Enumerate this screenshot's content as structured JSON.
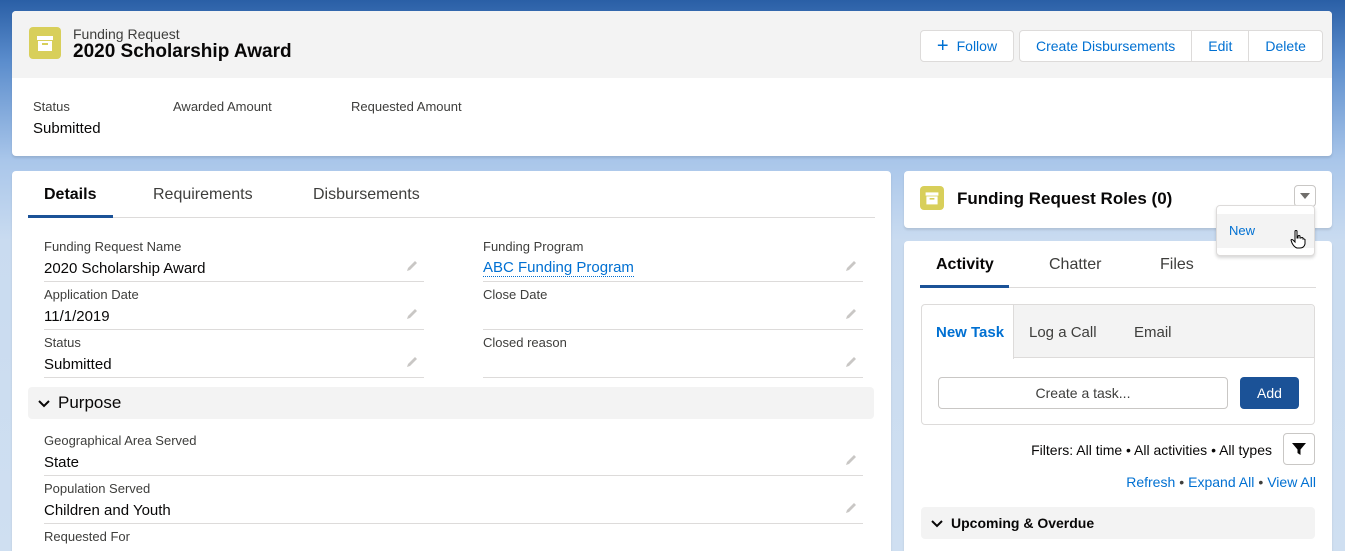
{
  "header": {
    "object_type": "Funding Request",
    "record_name": "2020 Scholarship Award",
    "follow_label": "Follow",
    "actions": [
      "Create Disbursements",
      "Edit",
      "Delete"
    ],
    "highlights": [
      {
        "label": "Status",
        "value": "Submitted"
      },
      {
        "label": "Awarded Amount",
        "value": ""
      },
      {
        "label": "Requested Amount",
        "value": ""
      }
    ]
  },
  "details": {
    "tabs": [
      "Details",
      "Requirements",
      "Disbursements"
    ],
    "active_tab": "Details",
    "fields": {
      "funding_request_name": {
        "label": "Funding Request Name",
        "value": "2020 Scholarship Award"
      },
      "funding_program": {
        "label": "Funding Program",
        "value": "ABC Funding Program"
      },
      "application_date": {
        "label": "Application Date",
        "value": "11/1/2019"
      },
      "close_date": {
        "label": "Close Date",
        "value": ""
      },
      "status": {
        "label": "Status",
        "value": "Submitted"
      },
      "closed_reason": {
        "label": "Closed reason",
        "value": ""
      },
      "geo_area": {
        "label": "Geographical Area Served",
        "value": "State"
      },
      "population": {
        "label": "Population Served",
        "value": "Children and Youth"
      },
      "requested_for": {
        "label": "Requested For",
        "value": ""
      }
    },
    "section_purpose": "Purpose"
  },
  "roles": {
    "title": "Funding Request Roles (0)",
    "menu_items": [
      "New"
    ]
  },
  "activity": {
    "tabs": [
      "Activity",
      "Chatter",
      "Files"
    ],
    "active_tab": "Activity",
    "subtabs": [
      "New Task",
      "Log a Call",
      "Email"
    ],
    "task_placeholder": "Create a task...",
    "add_label": "Add",
    "filters_text": "Filters: All time • All activities • All types",
    "links": [
      "Refresh",
      "Expand All",
      "View All"
    ],
    "upcoming_label": "Upcoming & Overdue"
  },
  "colors": {
    "brand": "#1b5297",
    "link": "#0070d2",
    "object_icon": "#d8cf5a"
  },
  "icons": [
    "archive-icon",
    "plus-icon",
    "pencil-icon",
    "chevron-down-icon",
    "filter-icon",
    "hand-cursor-icon"
  ]
}
